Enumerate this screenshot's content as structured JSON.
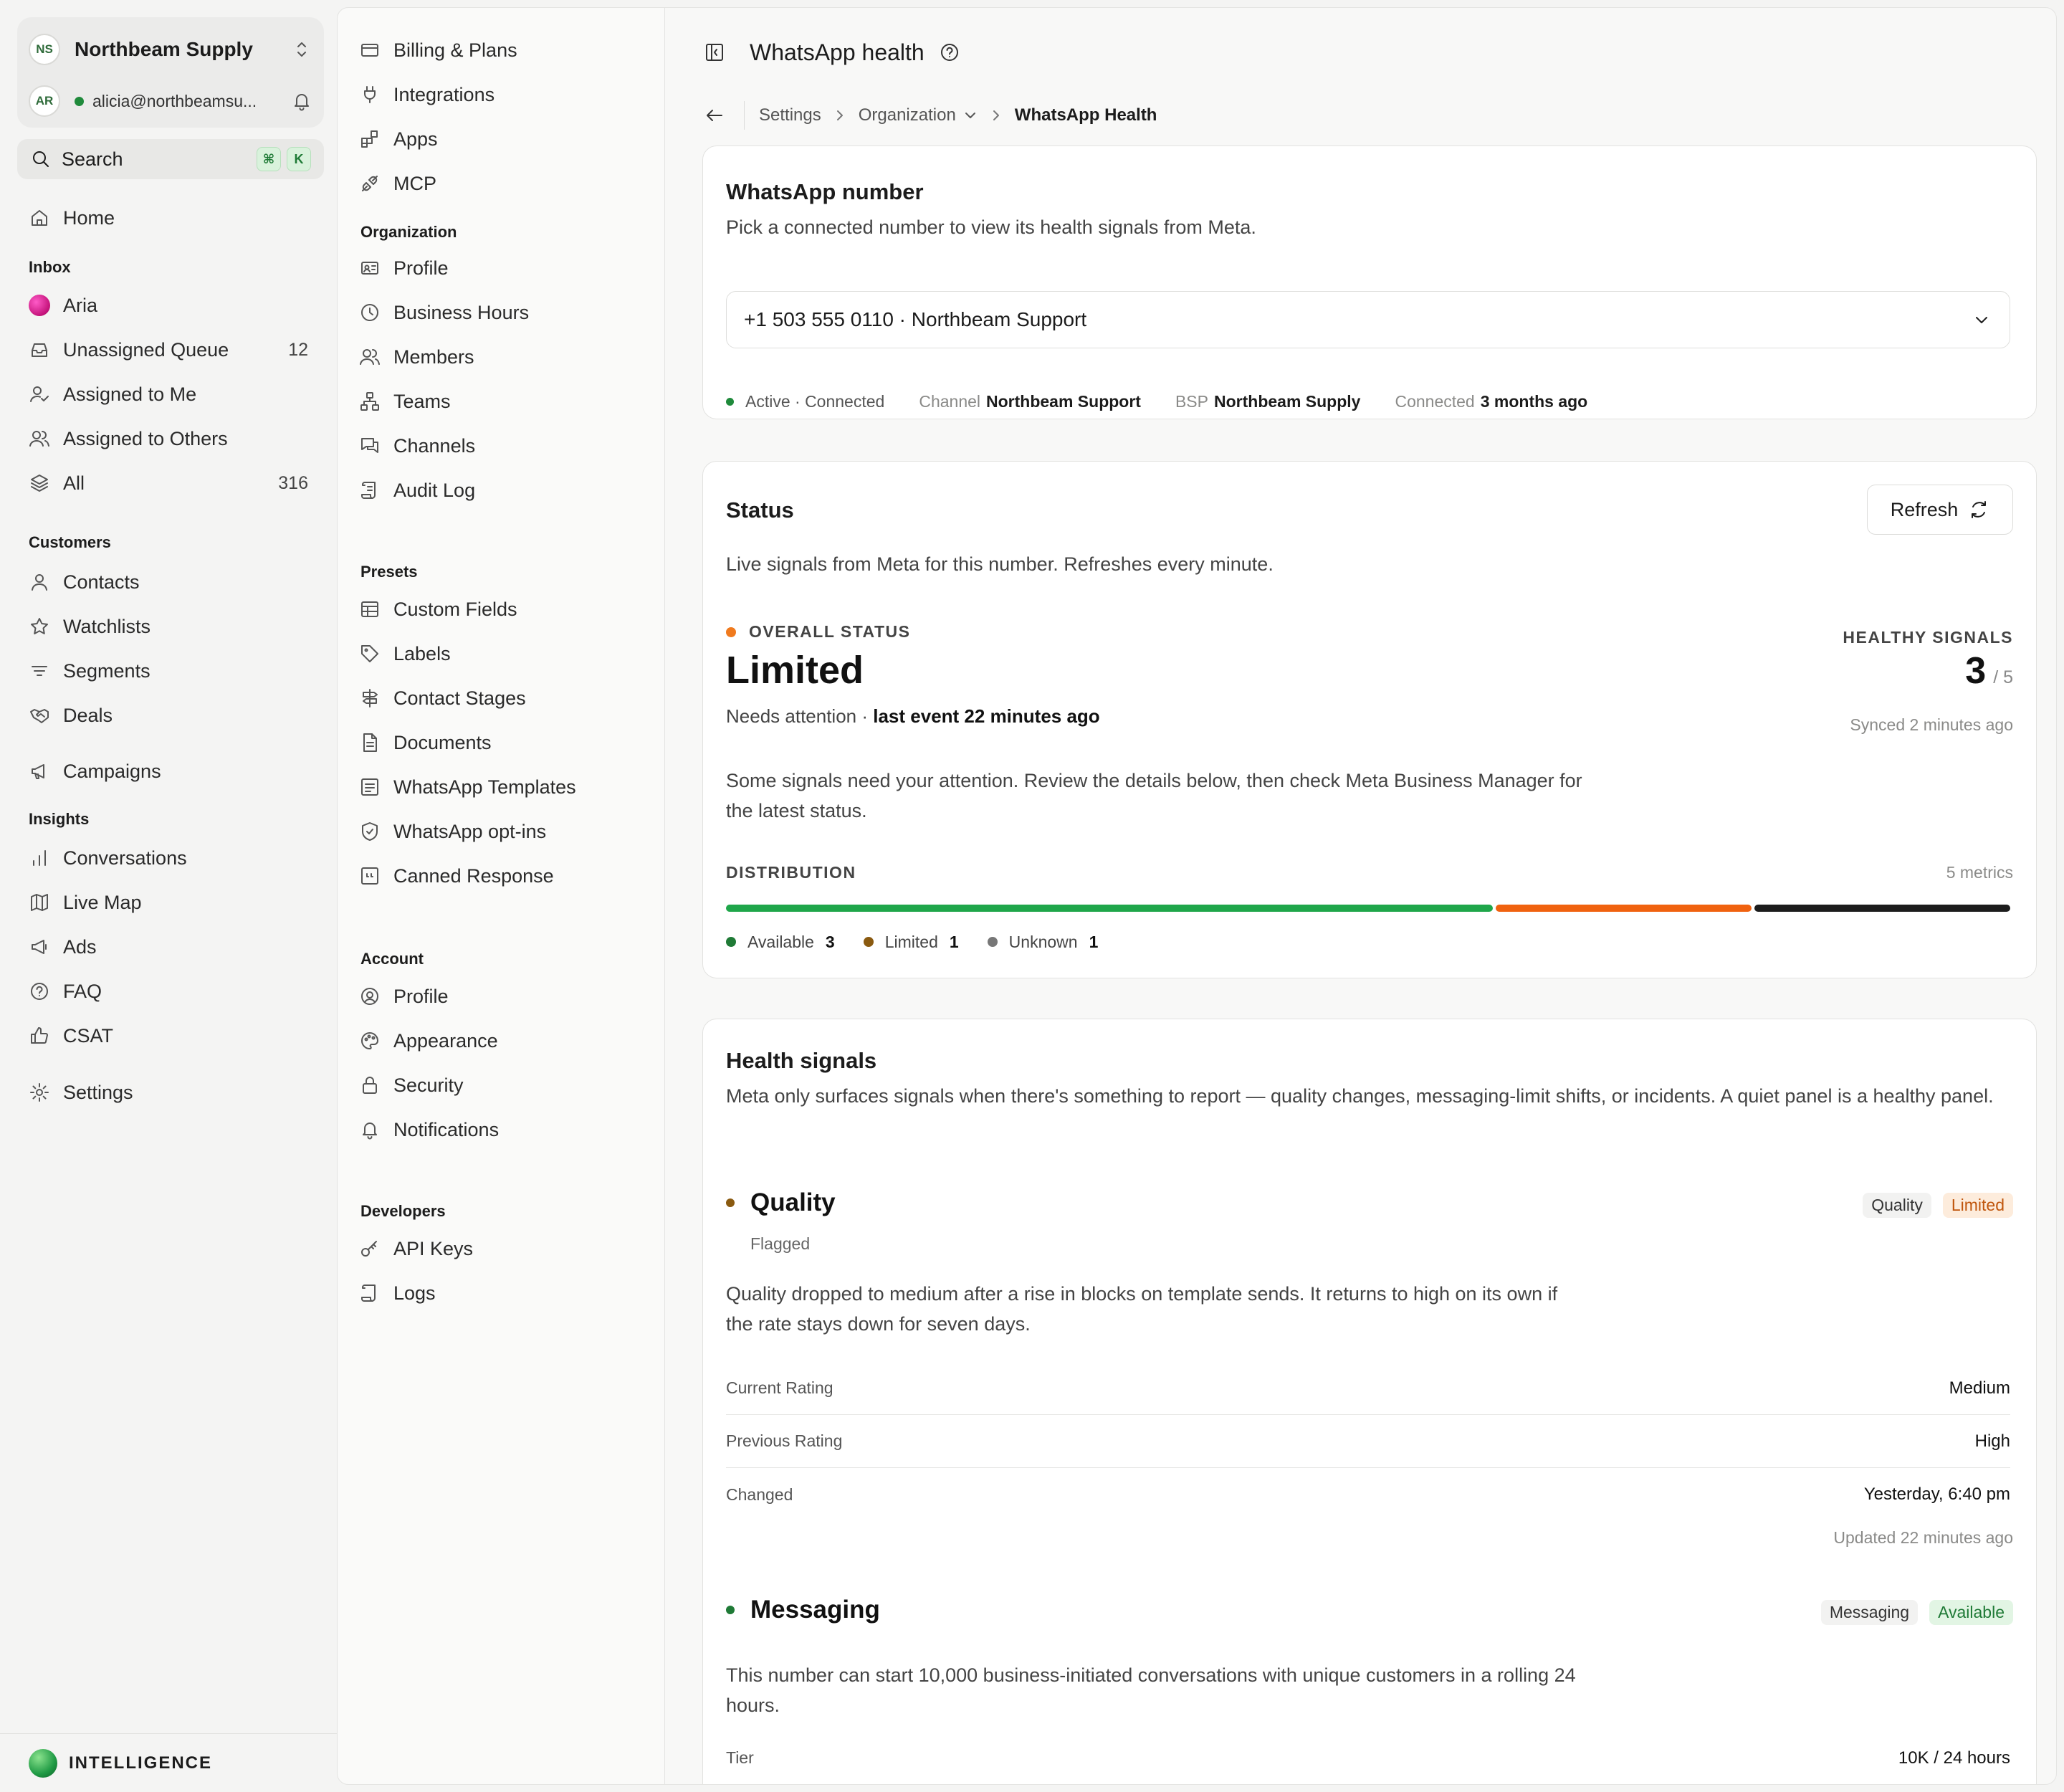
{
  "org": {
    "initials": "NS",
    "name": "Northbeam Supply"
  },
  "user": {
    "initials": "AR",
    "email": "alicia@northbeamsu..."
  },
  "search": {
    "label": "Search",
    "kbd1": "⌘",
    "kbd2": "K"
  },
  "sidebar": {
    "home": "Home",
    "inbox_heading": "Inbox",
    "inbox": [
      {
        "label": "Aria",
        "count": ""
      },
      {
        "label": "Unassigned Queue",
        "count": "12"
      },
      {
        "label": "Assigned to Me",
        "count": ""
      },
      {
        "label": "Assigned to Others",
        "count": ""
      },
      {
        "label": "All",
        "count": "316"
      }
    ],
    "customers_heading": "Customers",
    "customers": [
      "Contacts",
      "Watchlists",
      "Segments",
      "Deals"
    ],
    "campaigns": "Campaigns",
    "insights_heading": "Insights",
    "insights": [
      "Conversations",
      "Live Map",
      "Ads",
      "FAQ",
      "CSAT"
    ],
    "settings": "Settings",
    "intelligence": "INTELLIGENCE"
  },
  "settings_nav": {
    "top": [
      "Billing & Plans",
      "Integrations",
      "Apps",
      "MCP"
    ],
    "organization_heading": "Organization",
    "organization": [
      "Profile",
      "Business Hours",
      "Members",
      "Teams",
      "Channels",
      "Audit Log"
    ],
    "presets_heading": "Presets",
    "presets": [
      "Custom Fields",
      "Labels",
      "Contact Stages",
      "Documents",
      "WhatsApp Templates",
      "WhatsApp opt-ins",
      "Canned Response"
    ],
    "account_heading": "Account",
    "account": [
      "Profile",
      "Appearance",
      "Security",
      "Notifications"
    ],
    "developers_heading": "Developers",
    "developers": [
      "API Keys",
      "Logs"
    ]
  },
  "header": {
    "title": "WhatsApp health"
  },
  "breadcrumb": {
    "settings": "Settings",
    "organization": "Organization",
    "current": "WhatsApp Health"
  },
  "number_card": {
    "title": "WhatsApp number",
    "subtitle": "Pick a connected number to view its health signals from Meta.",
    "selected": "+1 503 555 0110 · Northbeam Support",
    "status": "Active · Connected",
    "channel_key": "Channel",
    "channel_val": "Northbeam Support",
    "bsp_key": "BSP",
    "bsp_val": "Northbeam Supply",
    "connected_key": "Connected",
    "connected_val": "3 months ago"
  },
  "status_card": {
    "title": "Status",
    "refresh": "Refresh",
    "subtitle": "Live signals from Meta for this number. Refreshes every minute.",
    "overall_label": "OVERALL STATUS",
    "overall_value": "Limited",
    "overall_desc": "Needs attention ·",
    "overall_last": "last event 22 minutes ago",
    "healthy_label": "HEALTHY SIGNALS",
    "healthy_value": "3",
    "healthy_total": "/ 5",
    "synced": "Synced 2 minutes ago",
    "note": "Some signals need your attention. Review the details below, then check Meta Business Manager for the latest status.",
    "distribution_label": "DISTRIBUTION",
    "distribution_count": "5 metrics",
    "distribution": [
      {
        "label": "Available",
        "value": 3,
        "color": "#1fa64a"
      },
      {
        "label": "Limited",
        "value": 1,
        "color": "#f0620f"
      },
      {
        "label": "Unknown",
        "value": 1,
        "color": "#1c1c1c"
      }
    ],
    "legend_colors": [
      "#1f7a36",
      "#8a5a10",
      "#777777"
    ]
  },
  "health_card": {
    "title": "Health signals",
    "subtitle": "Meta only surfaces signals when there's something to report — quality changes, messaging-limit shifts, or incidents. A quiet panel is a healthy panel.",
    "quality": {
      "title": "Quality",
      "sub": "Flagged",
      "tag1": "Quality",
      "tag2": "Limited",
      "text": "Quality dropped to medium after a rise in blocks on template sends. It returns to high on its own if the rate stays down for seven days.",
      "rows": [
        {
          "k": "Current Rating",
          "v": "Medium"
        },
        {
          "k": "Previous Rating",
          "v": "High"
        },
        {
          "k": "Changed",
          "v": "Yesterday, 6:40 pm"
        }
      ],
      "updated": "Updated 22 minutes ago"
    },
    "messaging": {
      "title": "Messaging",
      "tag1": "Messaging",
      "tag2": "Available",
      "text": "This number can start 10,000 business-initiated conversations with unique customers in a rolling 24 hours.",
      "rows": [
        {
          "k": "Tier",
          "v": "10K / 24 hours"
        }
      ]
    }
  }
}
